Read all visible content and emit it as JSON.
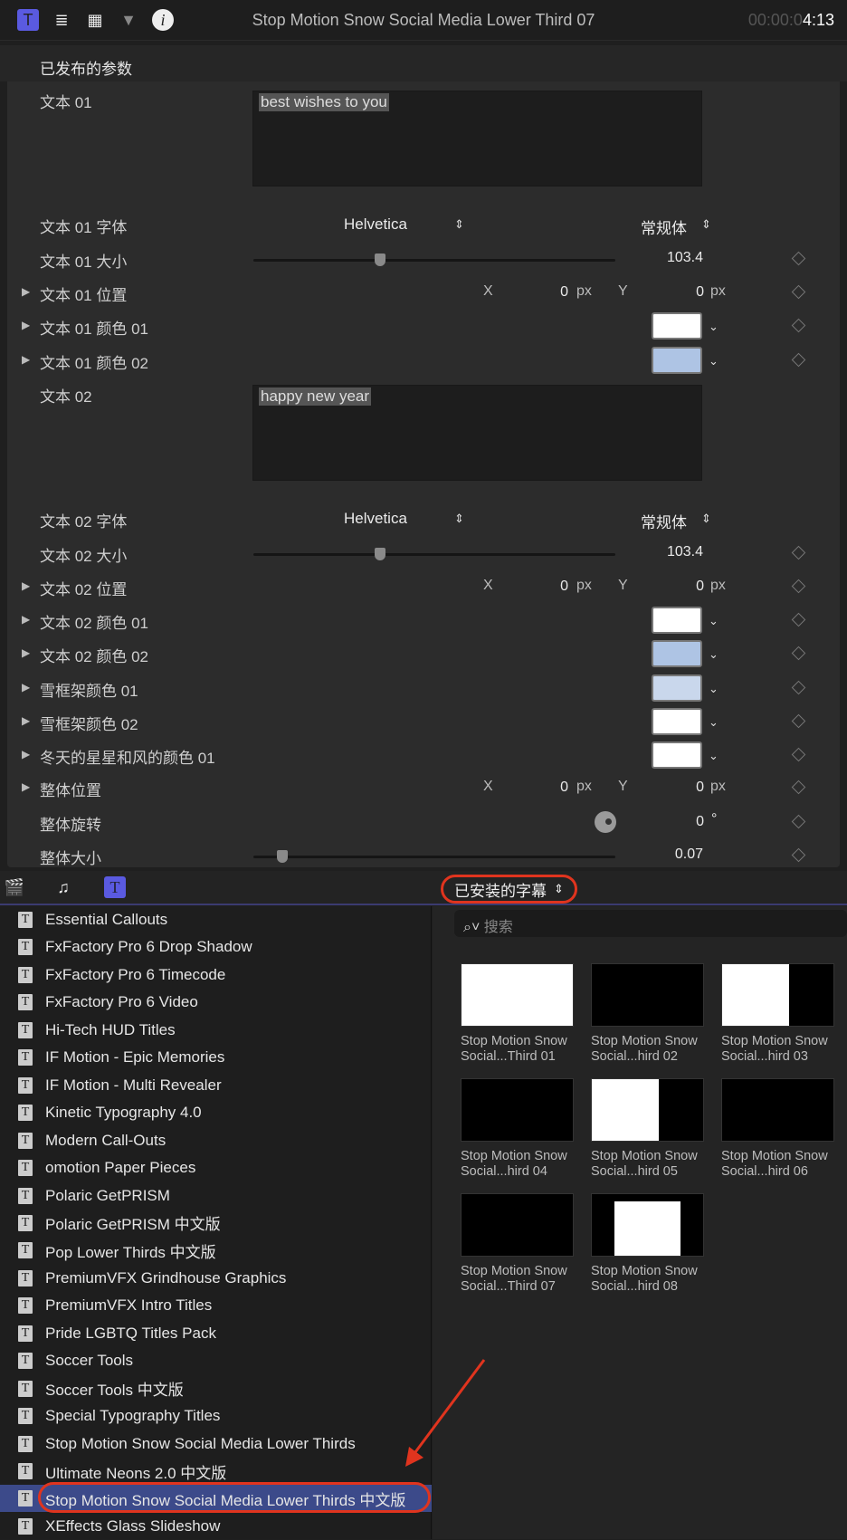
{
  "header": {
    "icons": [
      "title-t-icon",
      "text-lines-icon",
      "film-icon",
      "shape-icon",
      "info-icon"
    ],
    "title": "Stop Motion Snow Social Media Lower Third 07",
    "timecode_dim": "00:00:0",
    "timecode": "4:13"
  },
  "inspector": {
    "section": "已发布的参数",
    "rows": [
      {
        "type": "text",
        "label": "文本 01",
        "value": "best wishes to you"
      },
      {
        "type": "font",
        "label": "文本 01 字体",
        "font": "Helvetica",
        "style": "常规体"
      },
      {
        "type": "slider",
        "label": "文本 01 大小",
        "value": "103.4",
        "fraction": 0.35
      },
      {
        "type": "pos",
        "label": "文本 01 位置",
        "x": "0",
        "y": "0",
        "unit": "px",
        "xl": "X",
        "yl": "Y"
      },
      {
        "type": "color",
        "label": "文本 01 颜色 01",
        "color": "#ffffff"
      },
      {
        "type": "color",
        "label": "文本 01 颜色 02",
        "color": "#aec4e4"
      },
      {
        "type": "text",
        "label": "文本 02",
        "value": "happy new year"
      },
      {
        "type": "font",
        "label": "文本 02 字体",
        "font": "Helvetica",
        "style": "常规体"
      },
      {
        "type": "slider",
        "label": "文本 02 大小",
        "value": "103.4",
        "fraction": 0.35
      },
      {
        "type": "pos",
        "label": "文本 02 位置",
        "x": "0",
        "y": "0",
        "unit": "px",
        "xl": "X",
        "yl": "Y"
      },
      {
        "type": "color",
        "label": "文本 02 颜色 01",
        "color": "#ffffff"
      },
      {
        "type": "color",
        "label": "文本 02 颜色 02",
        "color": "#aec4e4"
      },
      {
        "type": "color",
        "label": "雪框架颜色 01",
        "color": "#c9d7ec"
      },
      {
        "type": "color",
        "label": "雪框架颜色 02",
        "color": "#ffffff"
      },
      {
        "type": "color",
        "label": "冬天的星星和风的颜色 01",
        "color": "#ffffff"
      },
      {
        "type": "pos",
        "label": "整体位置",
        "x": "0",
        "y": "0",
        "unit": "px",
        "xl": "X",
        "yl": "Y"
      },
      {
        "type": "rot",
        "label": "整体旋转",
        "value": "0",
        "unit": "°"
      },
      {
        "type": "slider",
        "label": "整体大小",
        "value": "0.07",
        "fraction": 0.08
      }
    ]
  },
  "browser": {
    "toolbar_icons": [
      "clapper-star-icon",
      "music-photo-icon",
      "titles-icon"
    ],
    "category": "已安装的字幕",
    "search_placeholder": "搜索",
    "items": [
      "Essential Callouts",
      "FxFactory Pro 6 Drop Shadow",
      "FxFactory Pro 6 Timecode",
      "FxFactory Pro 6 Video",
      "Hi-Tech HUD Titles",
      "IF Motion - Epic Memories",
      "IF Motion - Multi Revealer",
      "Kinetic Typography 4.0",
      "Modern Call-Outs",
      "omotion Paper Pieces",
      "Polaric GetPRISM",
      "Polaric GetPRISM 中文版",
      "Pop Lower Thirds 中文版",
      "PremiumVFX Grindhouse Graphics",
      "PremiumVFX Intro Titles",
      "Pride LGBTQ Titles Pack",
      "Soccer Tools",
      "Soccer Tools 中文版",
      "Special Typography Titles",
      "Stop Motion Snow Social Media Lower Thirds",
      "Ultimate Neons 2.0 中文版",
      "Stop Motion Snow Social Media Lower Thirds 中文版",
      "XEffects Glass Slideshow"
    ],
    "selected_index": 21,
    "thumbs": [
      {
        "l1": "Stop Motion Snow",
        "l2": "Social...Third 01",
        "bg": "white"
      },
      {
        "l1": "Stop Motion Snow",
        "l2": "Social...hird 02",
        "bg": "black"
      },
      {
        "l1": "Stop Motion Snow",
        "l2": "Social...hird 03",
        "bg": "split"
      },
      {
        "l1": "Stop Motion Snow",
        "l2": "Social...hird 04",
        "bg": "black"
      },
      {
        "l1": "Stop Motion Snow",
        "l2": "Social...hird 05",
        "bg": "split"
      },
      {
        "l1": "Stop Motion Snow",
        "l2": "Social...hird 06",
        "bg": "black"
      },
      {
        "l1": "Stop Motion Snow",
        "l2": "Social...Third 07",
        "bg": "black"
      },
      {
        "l1": "Stop Motion Snow",
        "l2": "Social...hird 08",
        "bg": "center"
      }
    ]
  },
  "accent": "#e0341e"
}
